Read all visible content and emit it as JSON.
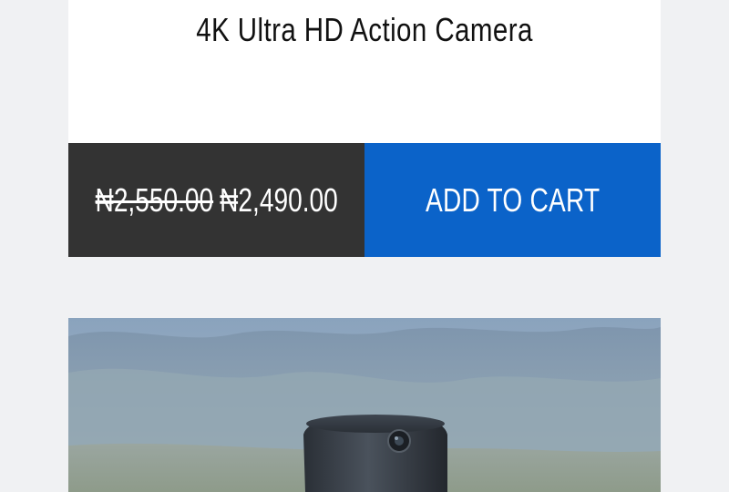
{
  "product": {
    "title": "4K Ultra HD Action Camera",
    "old_price": "₦2,550.00",
    "new_price": "₦2,490.00",
    "add_to_cart_label": "ADD TO CART"
  },
  "colors": {
    "price_bar": "#333333",
    "cart_button": "#0b63c9",
    "page_background": "#f0f1f3"
  },
  "image": {
    "subject": "action-camera-on-hillside-photo"
  }
}
